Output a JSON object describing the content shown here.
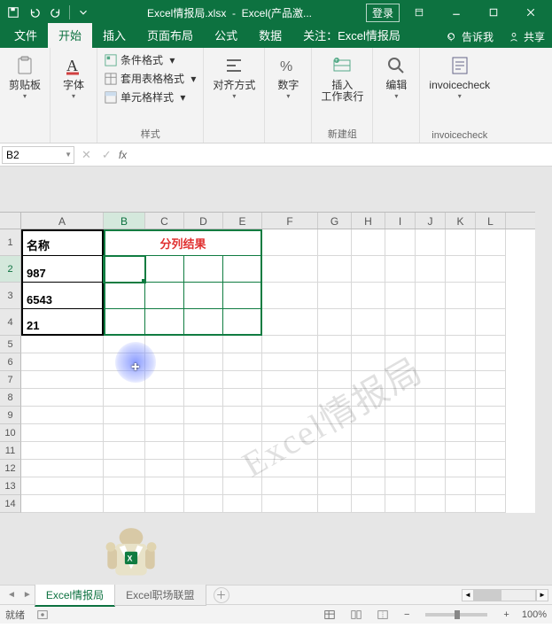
{
  "titlebar": {
    "filename": "Excel情报局.xlsx",
    "app_suffix": "Excel(产品激...",
    "login": "登录"
  },
  "tabs": {
    "file": "文件",
    "home": "开始",
    "insert": "插入",
    "layout": "页面布局",
    "formula": "公式",
    "data": "数据",
    "attention": "关注：Excel情报局",
    "tellme": "告诉我",
    "share": "共享"
  },
  "ribbon": {
    "clipboard": {
      "btn": "剪贴板",
      "group": ""
    },
    "font": {
      "btn": "字体"
    },
    "styles": {
      "cond": "条件格式",
      "table": "套用表格格式",
      "cell": "单元格样式",
      "group": "样式"
    },
    "align": {
      "btn": "对齐方式"
    },
    "number": {
      "btn": "数字"
    },
    "new": {
      "btn": "插入\n工作表行",
      "group": "新建组"
    },
    "edit": {
      "btn": "编辑"
    },
    "inv": {
      "btn": "invoicecheck",
      "group": "invoicecheck"
    }
  },
  "namebox": "B2",
  "columns": [
    "A",
    "B",
    "C",
    "D",
    "E",
    "F",
    "G",
    "H",
    "I",
    "J",
    "K",
    "L"
  ],
  "rows_tall": [
    "1",
    "2",
    "3",
    "4"
  ],
  "rows_short": [
    "5",
    "6",
    "7",
    "8",
    "9",
    "10",
    "11",
    "12",
    "13",
    "14"
  ],
  "cells": {
    "A1": "名称",
    "BE1": "分列结果",
    "A2": "987",
    "A3": "6543",
    "A4": "21"
  },
  "watermark": "Excel情报局",
  "sheets": {
    "active": "Excel情报局",
    "other": "Excel职场联盟"
  },
  "status": {
    "ready": "就绪",
    "zoom": "100%"
  },
  "chart_data": {
    "type": "table",
    "title": "分列结果",
    "row_header": "名称",
    "rows": [
      "987",
      "6543",
      "21"
    ]
  }
}
